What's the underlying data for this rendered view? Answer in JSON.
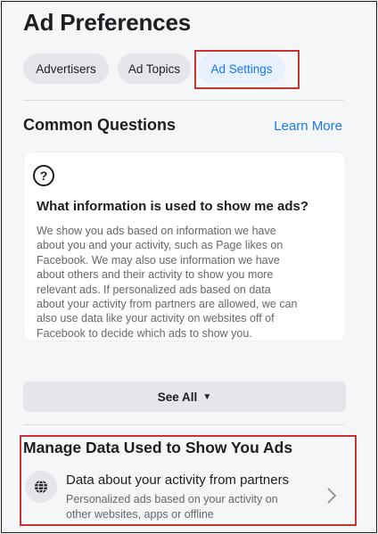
{
  "header": {
    "title": "Ad Preferences"
  },
  "tabs": [
    {
      "label": "Advertisers",
      "active": false
    },
    {
      "label": "Ad Topics",
      "active": false
    },
    {
      "label": "Ad Settings",
      "active": true
    }
  ],
  "common_questions": {
    "title": "Common Questions",
    "learn_more": "Learn More",
    "icon": "question-circle-icon",
    "question": "What information is used to show me ads?",
    "answer_lines": [
      "We show you ads based on information we have",
      "about you and your activity, such as Page likes on",
      "Facebook. We may also use information we have",
      "about others and their activity to show you more",
      "relevant ads. If personalized ads based on data",
      "about your activity from partners are allowed, we can",
      "also use data like your activity on websites off of",
      "Facebook to decide which ads to show you."
    ],
    "see_all": "See All"
  },
  "manage_data": {
    "title": "Manage Data Used to Show You Ads",
    "item": {
      "icon": "globe-icon",
      "title": "Data about your activity from partners",
      "description_lines": [
        "Personalized ads based on your activity on",
        "other websites, apps or offline"
      ]
    }
  },
  "colors": {
    "accent": "#1877f2",
    "highlight": "#c63433",
    "page_bg": "#f5f6f8",
    "chip_bg": "#e4e6eb"
  }
}
